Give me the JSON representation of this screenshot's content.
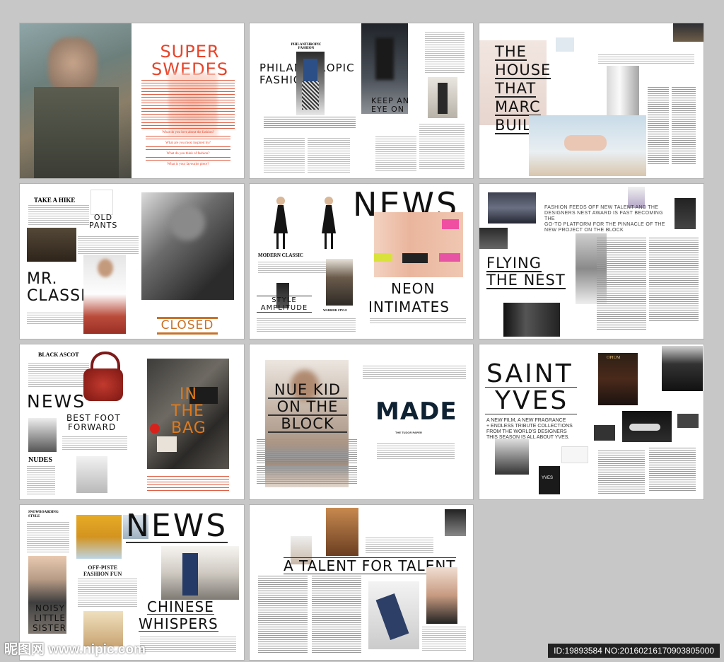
{
  "spreads": {
    "s1": {
      "headline": "SUPER SWEDES",
      "questions": [
        "What do you love about the fashion?",
        "What are you most inspired by?",
        "What do you think of fashion?",
        "What is your favourite piece?"
      ]
    },
    "s2": {
      "kicker": "PHILANTHROPIC FASHION",
      "headline": "PHILANTHROPIC FASHION",
      "headline2": "KEEP AN EYE ON"
    },
    "s3": {
      "headline": [
        "THE",
        "HOUSE",
        "THAT",
        "MARC",
        "BUILT"
      ]
    },
    "s4": {
      "kicker": "TAKE A HIKE",
      "headline": [
        "MR.",
        "CLASSIC"
      ],
      "label_old_pants": "OLD PANTS",
      "label_closed": "CLOSED"
    },
    "s5": {
      "headline": "NEWS",
      "modern_classic": "MODERN CLASSIC",
      "style_amplitude": "STYLE AMPLITUDE",
      "warrior_style": "WARRIOR STYLE",
      "neon": [
        "NEON",
        "INTIMATES"
      ]
    },
    "s6": {
      "intro": [
        "FASHION FEEDS OFF NEW TALENT AND THE",
        "DESIGNERS NEST AWARD IS FAST BECOMING THE",
        "GO-TO PLATFORM FOR THE PINNACLE OF THE",
        "NEW PROJECT ON THE BLOCK"
      ],
      "headline": [
        "FLYING",
        "THE NEST"
      ]
    },
    "s7": {
      "kicker": "BLACK ASCOT",
      "headline": "NEWS",
      "best_foot": [
        "BEST FOOT",
        "FORWARD"
      ],
      "nudes": "NUDES",
      "in_the_bag": [
        "IN",
        "THE",
        "BAG"
      ]
    },
    "s8": {
      "headline": [
        "NUE KID",
        "ON THE",
        "BLOCK"
      ],
      "made": "MADE",
      "made_sub": "THE TUDOR PAPER"
    },
    "s9": {
      "headline": [
        "SAINT",
        "YVES"
      ],
      "intro": [
        "A NEW FILM, A NEW FRAGRANCE",
        "+ ENDLESS TRIBUTE COLLECTIONS",
        "FROM THE WORLD'S DESIGNERS",
        "THIS SEASON IS ALL ABOUT YVES."
      ],
      "opium": "OPIUM",
      "yves_label": "YVES"
    },
    "s10": {
      "kicker": "SNOWBOARDING STYLE",
      "headline": "NEWS",
      "off_piste": [
        "OFF-PISTE",
        "FASHION FUN"
      ],
      "noisy": [
        "NOISY",
        "LITTLE",
        "SISTER"
      ],
      "chinese": [
        "CHINESE",
        "WHISPERS"
      ]
    },
    "s11": {
      "headline": "A TALENT FOR TALENT"
    }
  },
  "watermark": {
    "left": "昵图网 www.nipic.com",
    "right": "ID:19893584 NO:20160216170903805000"
  },
  "colors": {
    "accent_red": "#e8442a",
    "accent_orange": "#e07a1a",
    "ink": "#111111",
    "navy": "#0f2233",
    "background": "#c7c7c7"
  }
}
